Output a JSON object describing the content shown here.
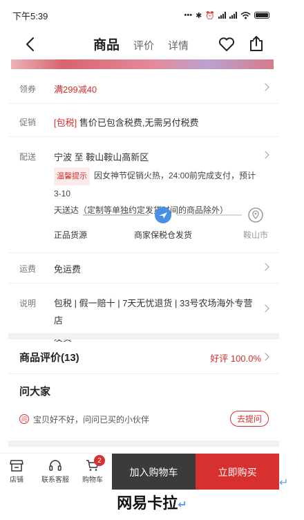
{
  "status_bar": {
    "time": "下午5:39"
  },
  "nav": {
    "tab_product": "商品",
    "tab_reviews": "评价",
    "tab_details": "详情"
  },
  "coupon": {
    "label": "领券",
    "value": "满299减40"
  },
  "promotion": {
    "label": "促销",
    "tag": "[包税]",
    "text": "售价已包含税费,无需另付税费"
  },
  "delivery": {
    "label": "配送",
    "route": "宁波 至 鞍山鞍山高新区",
    "notice_tag": "温馨提示",
    "notice_line1": "因女神节促销火热，24:00前完成支付，预计3-10",
    "notice_line2": "天送达（定制等单独约定发货时间的商品除外）",
    "steps": [
      "正品货源",
      "商家保税仓发货",
      "鞍山市"
    ],
    "brand_mark": "Kaola"
  },
  "shipping": {
    "label": "运费",
    "value": "免运费"
  },
  "description": {
    "label": "说明",
    "line1": "包税 | 假一赔十 | 7天无忧退货 | 33号农场海外专营店",
    "line2": "发货"
  },
  "reviews": {
    "title": "商品评价(13)",
    "rating": "好评 100.0%"
  },
  "qa": {
    "title": "问大家",
    "icon_char": "问",
    "question": "宝贝好不好，问问已买的小伙伴",
    "ask_button": "去提问"
  },
  "bottom_bar": {
    "store": "店铺",
    "service": "联系客服",
    "cart": "购物车",
    "cart_count": "2",
    "add_to_cart": "加入购物车",
    "buy_now": "立即购买"
  },
  "caption": "网易卡拉",
  "colors": {
    "accent_red": "#d8302e",
    "dark_button": "#3b3b3b",
    "progress_blue": "#4a90e2"
  }
}
